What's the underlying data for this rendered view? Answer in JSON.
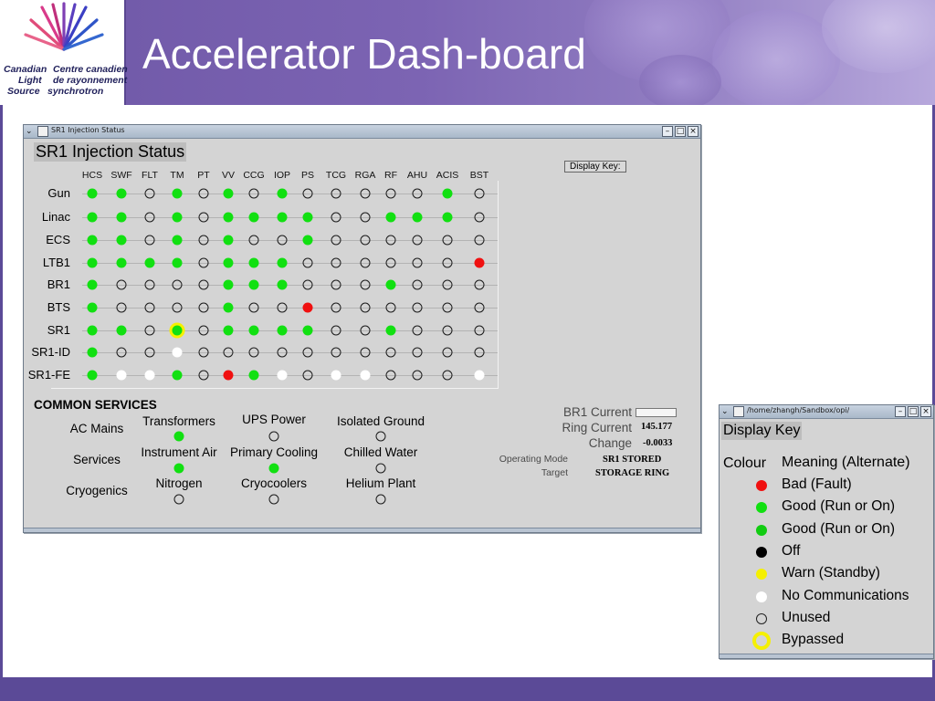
{
  "slide": {
    "title": "Accelerator Dash-board",
    "logo": {
      "line1_left": "Canadian",
      "line1_right": "Centre canadien",
      "line2_left": "Light",
      "line2_right": "de rayonnement",
      "line3_left": "Source",
      "line3_right": "synchrotron"
    },
    "colors": {
      "banner": "#7c64b3",
      "footer": "#5b4a97"
    }
  },
  "main_window": {
    "titlebar_text": "SR1 Injection Status",
    "buttons": [
      "minimize",
      "maximize",
      "close"
    ],
    "heading": "SR1 Injection Status",
    "display_key_button": "Display Key:",
    "columns": [
      "HCS",
      "SWF",
      "FLT",
      "TM",
      "PT",
      "VV",
      "CCG",
      "IOP",
      "PS",
      "TCG",
      "RGA",
      "RF",
      "AHU",
      "ACIS",
      "BST"
    ],
    "rows": [
      {
        "name": "Gun",
        "status": [
          "G",
          "G",
          "U",
          "G",
          "U",
          "G",
          "U",
          "G",
          "U",
          "U",
          "U",
          "U",
          "U",
          "G",
          "U"
        ]
      },
      {
        "name": "Linac",
        "status": [
          "G",
          "G",
          "U",
          "G",
          "U",
          "G",
          "G",
          "G",
          "G",
          "U",
          "U",
          "G",
          "G",
          "G",
          "U"
        ]
      },
      {
        "name": "ECS",
        "status": [
          "G",
          "G",
          "U",
          "G",
          "U",
          "G",
          "U",
          "U",
          "G",
          "U",
          "U",
          "U",
          "U",
          "U",
          "U"
        ]
      },
      {
        "name": "LTB1",
        "status": [
          "G",
          "G",
          "G",
          "G",
          "U",
          "G",
          "G",
          "G",
          "U",
          "U",
          "U",
          "U",
          "U",
          "U",
          "R"
        ]
      },
      {
        "name": "BR1",
        "status": [
          "G",
          "U",
          "U",
          "U",
          "U",
          "G",
          "G",
          "G",
          "U",
          "U",
          "U",
          "G",
          "U",
          "U",
          "U"
        ]
      },
      {
        "name": "BTS",
        "status": [
          "G",
          "U",
          "U",
          "U",
          "U",
          "G",
          "U",
          "U",
          "R",
          "U",
          "U",
          "U",
          "U",
          "U",
          "U"
        ]
      },
      {
        "name": "SR1",
        "status": [
          "G",
          "G",
          "U",
          "B",
          "U",
          "G",
          "G",
          "G",
          "G",
          "U",
          "U",
          "G",
          "U",
          "U",
          "U"
        ]
      },
      {
        "name": "SR1-ID",
        "status": [
          "G",
          "U",
          "U",
          "W",
          "U",
          "U",
          "U",
          "U",
          "U",
          "U",
          "U",
          "U",
          "U",
          "U",
          "U"
        ]
      },
      {
        "name": "SR1-FE",
        "status": [
          "G",
          "W",
          "W",
          "G",
          "U",
          "R",
          "G",
          "W",
          "U",
          "W",
          "W",
          "U",
          "U",
          "U",
          "W"
        ]
      }
    ],
    "status_legend_codes": {
      "G": "good",
      "R": "bad",
      "W": "no-comm",
      "U": "unused",
      "B": "bypassed"
    },
    "common_services": {
      "title": "COMMON SERVICES",
      "items": [
        {
          "label": "AC Mains",
          "status": "none"
        },
        {
          "label": "Transformers",
          "status": "G"
        },
        {
          "label": "UPS Power",
          "status": "U"
        },
        {
          "label": "Isolated Ground",
          "status": "U"
        },
        {
          "label": "Services",
          "status": "none"
        },
        {
          "label": "Instrument Air",
          "status": "G"
        },
        {
          "label": "Primary Cooling",
          "status": "G"
        },
        {
          "label": "Chilled Water",
          "status": "U"
        },
        {
          "label": "Cryogenics",
          "status": "none"
        },
        {
          "label": "Nitrogen",
          "status": "U"
        },
        {
          "label": "Cryocoolers",
          "status": "U"
        },
        {
          "label": "Helium Plant",
          "status": "U"
        }
      ]
    },
    "readouts": {
      "br1_current_label": "BR1 Current",
      "br1_current_value": "",
      "ring_current_label": "Ring Current",
      "ring_current_value": "145.177",
      "change_label": "Change",
      "change_value": "-0.0033",
      "operating_mode_label": "Operating Mode",
      "operating_mode_value": "SR1 STORED",
      "target_label": "Target",
      "target_value": "STORAGE RING"
    }
  },
  "key_window": {
    "titlebar_text": "/home/zhangh/Sandbox/opi/",
    "heading": "Display Key",
    "col_colour": "Colour",
    "col_meaning": "Meaning (Alternate)",
    "entries": [
      {
        "color": "#f01010",
        "style": "fill",
        "meaning": "Bad (Fault)"
      },
      {
        "color": "#11e011",
        "style": "fill",
        "meaning": "Good (Run or On)"
      },
      {
        "color": "#11cc11",
        "style": "fill",
        "meaning": "Good (Run or On)"
      },
      {
        "color": "#000000",
        "style": "fill",
        "meaning": "Off"
      },
      {
        "color": "#f5f000",
        "style": "fill",
        "meaning": "Warn (Standby)"
      },
      {
        "color": "#ffffff",
        "style": "fill",
        "meaning": "No Communications"
      },
      {
        "color": "transparent",
        "style": "outline",
        "meaning": "Unused"
      },
      {
        "color": "#f5f000",
        "style": "ring",
        "meaning": "Bypassed"
      }
    ]
  }
}
